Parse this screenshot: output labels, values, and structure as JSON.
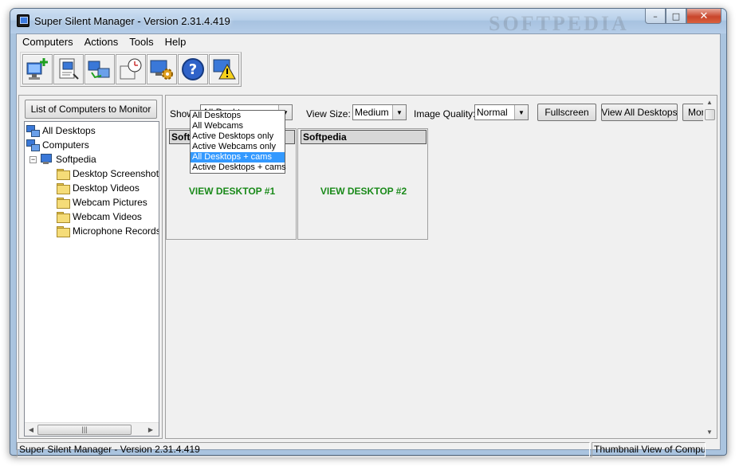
{
  "window": {
    "title": "Super Silent Manager - Version 2.31.4.419",
    "watermark": "SOFTPEDIA",
    "caption": {
      "minimize": "–",
      "maximize": "□",
      "close": "✕"
    }
  },
  "menu": [
    {
      "label": "Computers"
    },
    {
      "label": "Actions"
    },
    {
      "label": "Tools"
    },
    {
      "label": "Help"
    }
  ],
  "toolbar": {
    "icons": [
      "add-computer-icon",
      "monitor-schedule-icon",
      "network-scan-icon",
      "clock-settings-icon",
      "gear-settings-icon",
      "help-icon",
      "warning-icon"
    ]
  },
  "left_panel": {
    "list_button": "List of Computers to Monitor",
    "tree": [
      {
        "label": "All Desktops",
        "icon": "desktops-icon"
      },
      {
        "label": "Computers",
        "icon": "network-icon"
      },
      {
        "label": "Softpedia",
        "icon": "computer-icon",
        "expander": "−"
      },
      {
        "label": "Desktop Screenshots",
        "icon": "folder-icon"
      },
      {
        "label": "Desktop Videos",
        "icon": "folder-icon"
      },
      {
        "label": "Webcam Pictures",
        "icon": "folder-icon"
      },
      {
        "label": "Webcam Videos",
        "icon": "folder-icon"
      },
      {
        "label": "Microphone Records",
        "icon": "folder-icon"
      }
    ],
    "hscroll": {
      "left": "◀",
      "thumb": "|||",
      "right": "▶"
    }
  },
  "controls": {
    "show_label": "Show:",
    "show_value": "All Desktops + cams",
    "view_size_label": "View Size:",
    "view_size_value": "Medium",
    "quality_label": "Image Quality:",
    "quality_value": "Normal",
    "fullscreen": "Fullscreen",
    "view_all": "View All Desktops",
    "more": "Mor",
    "combo_arrow": "▼"
  },
  "dropdown": {
    "options": [
      "All Desktops",
      "All Webcams",
      "Active Desktops only",
      "Active Webcams only",
      "All Desktops + cams",
      "Active Desktops + cams"
    ],
    "selected_index": 4
  },
  "tiles": [
    {
      "header": "Softped",
      "link": "VIEW DESKTOP #1"
    },
    {
      "header": "Softpedia",
      "link": "VIEW DESKTOP #2"
    }
  ],
  "vscroll": {
    "up": "▲",
    "down": "▼"
  },
  "status": {
    "left": "Super Silent Manager - Version 2.31.4.419",
    "right": "Thumbnail View of Compu"
  }
}
